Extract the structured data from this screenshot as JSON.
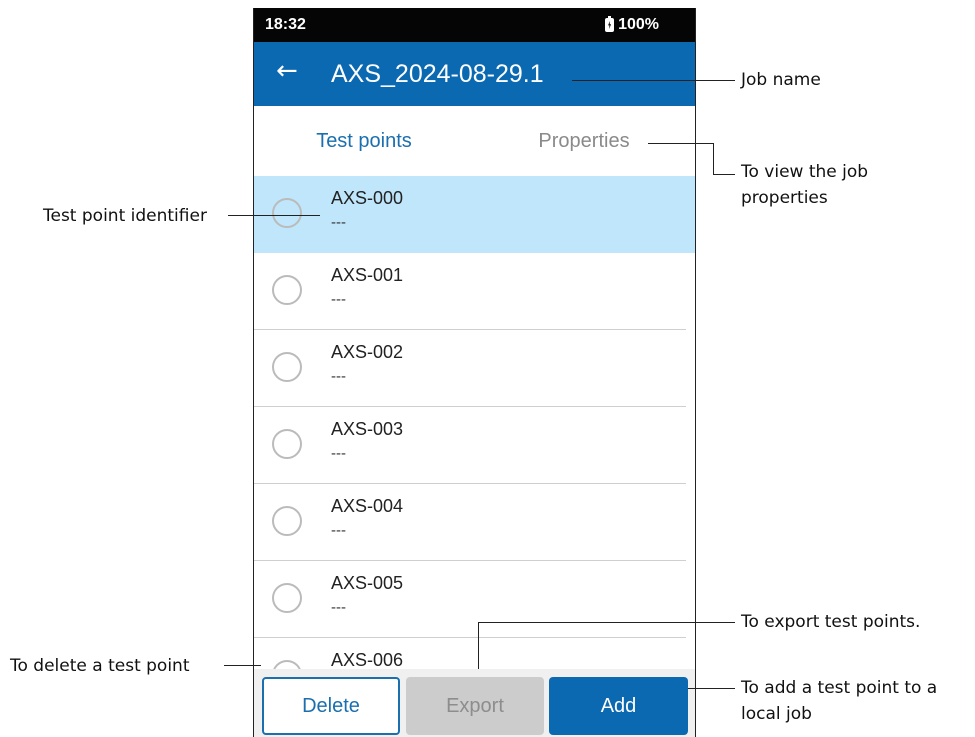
{
  "status": {
    "time": "18:32",
    "battery": "100%"
  },
  "header": {
    "title": "AXS_2024-08-29.1"
  },
  "tabs": [
    {
      "label": "Test points",
      "active": true
    },
    {
      "label": "Properties",
      "active": false
    }
  ],
  "test_points": [
    {
      "name": "AXS-000",
      "detail": "---",
      "selected": true
    },
    {
      "name": "AXS-001",
      "detail": "---",
      "selected": false
    },
    {
      "name": "AXS-002",
      "detail": "---",
      "selected": false
    },
    {
      "name": "AXS-003",
      "detail": "---",
      "selected": false
    },
    {
      "name": "AXS-004",
      "detail": "---",
      "selected": false
    },
    {
      "name": "AXS-005",
      "detail": "---",
      "selected": false
    },
    {
      "name": "AXS-006",
      "detail": "---",
      "selected": false
    }
  ],
  "buttons": {
    "delete": "Delete",
    "export": "Export",
    "add": "Add"
  },
  "callouts": {
    "job_name": "Job name",
    "view_properties_1": "To view the job",
    "view_properties_2": "properties",
    "test_point_identifier": "Test point identifier",
    "export": "To export test points.",
    "delete": "To delete a test point",
    "add_1": "To add a test point to a",
    "add_2": "local job"
  },
  "colors": {
    "appbar": "#0b69b2",
    "selected_row": "#bfe6fa",
    "active_tab_text": "#1b6fae",
    "disabled_button": "#cccccc"
  },
  "icons": {
    "back": "arrow-left-icon",
    "battery": "battery-charging-icon"
  }
}
